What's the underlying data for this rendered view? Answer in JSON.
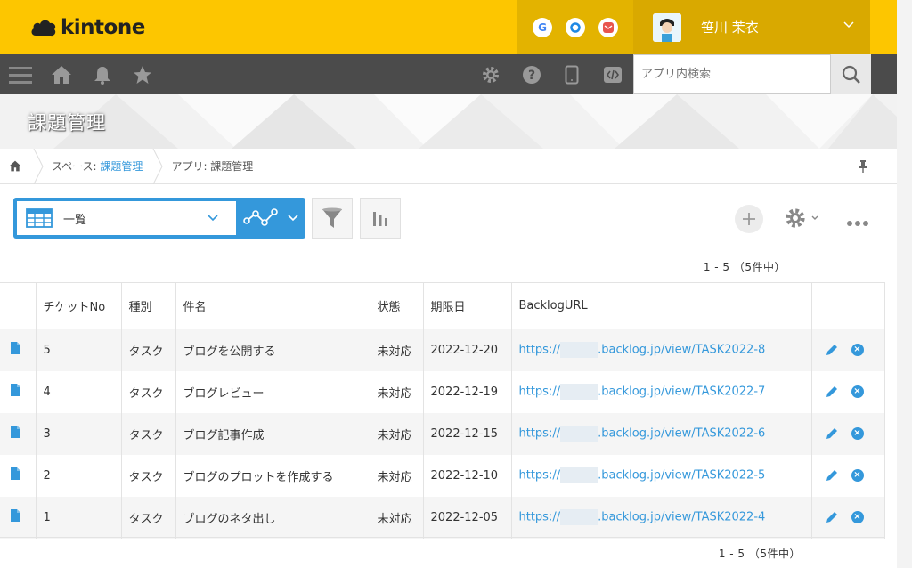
{
  "brand": {
    "logo_text": "kintone",
    "accent": "#fdc600",
    "link_color": "#3498db"
  },
  "apps": [
    {
      "name": "google-icon",
      "label": "G",
      "color": "#4285f4"
    },
    {
      "name": "office-icon",
      "label": "O",
      "color": "#1e88e5"
    },
    {
      "name": "mail-icon",
      "label": "✉",
      "color": "#e8554e"
    }
  ],
  "user": {
    "name": "笹川 茉衣"
  },
  "search": {
    "placeholder": "アプリ内検索",
    "value": ""
  },
  "app_title": "課題管理",
  "breadcrumb": {
    "space_prefix": "スペース: ",
    "space_link": "課題管理",
    "app_prefix": "アプリ: ",
    "app_name": "課題管理"
  },
  "view": {
    "selected": "一覧"
  },
  "pagination": {
    "text": "1 - 5 （5件中）"
  },
  "table": {
    "columns": [
      "チケットNo",
      "種別",
      "件名",
      "状態",
      "期限日",
      "BacklogURL"
    ],
    "rows": [
      {
        "no": "5",
        "type": "タスク",
        "subject": "ブログを公開する",
        "status": "未対応",
        "due": "2022-12-20",
        "url_prefix": "https://",
        "url_suffix": ".backlog.jp/view/TASK2022-8"
      },
      {
        "no": "4",
        "type": "タスク",
        "subject": "ブログレビュー",
        "status": "未対応",
        "due": "2022-12-19",
        "url_prefix": "https://",
        "url_suffix": ".backlog.jp/view/TASK2022-7"
      },
      {
        "no": "3",
        "type": "タスク",
        "subject": "ブログ記事作成",
        "status": "未対応",
        "due": "2022-12-15",
        "url_prefix": "https://",
        "url_suffix": ".backlog.jp/view/TASK2022-6"
      },
      {
        "no": "2",
        "type": "タスク",
        "subject": "ブログのプロットを作成する",
        "status": "未対応",
        "due": "2022-12-10",
        "url_prefix": "https://",
        "url_suffix": ".backlog.jp/view/TASK2022-5"
      },
      {
        "no": "1",
        "type": "タスク",
        "subject": "ブログのネタ出し",
        "status": "未対応",
        "due": "2022-12-05",
        "url_prefix": "https://",
        "url_suffix": ".backlog.jp/view/TASK2022-4"
      }
    ]
  }
}
